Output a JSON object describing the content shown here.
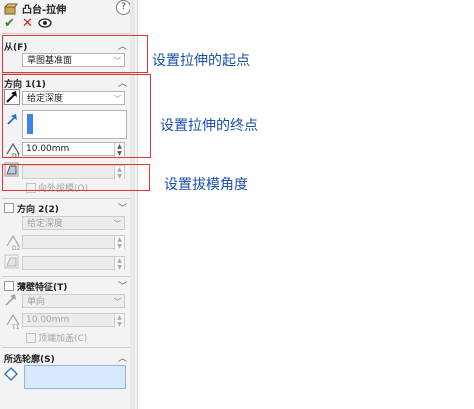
{
  "header": {
    "title": "凸台-拉伸",
    "help_icon": "?"
  },
  "actions": {
    "ok": "✔",
    "cancel": "✕",
    "preview": "👁"
  },
  "from_section": {
    "title": "从(F)",
    "value": "草图基准面"
  },
  "direction1": {
    "title": "方向 1(1)",
    "end_condition": "给定深度",
    "depth": "10.00mm",
    "draft_label": "向外拔模(O)"
  },
  "direction2": {
    "title": "方向 2(2)",
    "end_condition": "给定深度"
  },
  "thin": {
    "title": "薄壁特征(T)",
    "type": "单向",
    "thickness": "10.00mm",
    "cap_label": "顶端加盖(C)"
  },
  "contours": {
    "title": "所选轮廓(S)"
  },
  "annotations": {
    "start": "设置拉伸的起点",
    "end": "设置拉伸的终点",
    "draft": "设置拔模角度"
  },
  "colors": {
    "accent": "#e23636",
    "note_blue": "#1b4fa8",
    "ok_green": "#2e8b2e",
    "cancel_red": "#cc2222",
    "selection_blue": "#3a86e8"
  }
}
